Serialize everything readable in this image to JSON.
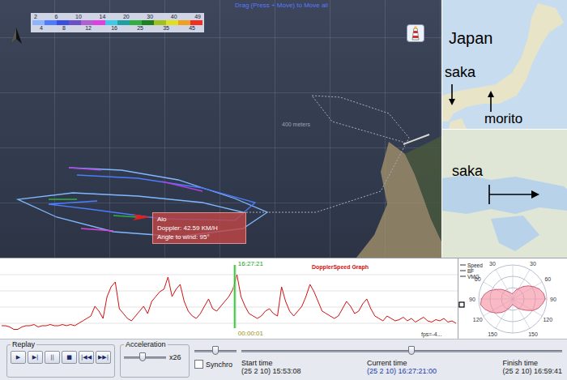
{
  "map": {
    "hint": "Drag (Press + Move) to Move all",
    "scale_text": "400 meters",
    "color_scale": {
      "colors": [
        "#8fb4ff",
        "#4f7cff",
        "#3a4fe0",
        "#6a4fc8",
        "#b060d0",
        "#e040e0",
        "#40c8e8",
        "#20a0a0",
        "#30b040",
        "#208020",
        "#a0c020",
        "#e0e020",
        "#f0a020",
        "#f03020"
      ],
      "top_labels": [
        "2",
        "6",
        "10",
        "14",
        "20",
        "30",
        "40",
        "49"
      ],
      "bottom_labels": [
        "4",
        "8",
        "12",
        "16",
        "25",
        "35",
        "45"
      ]
    },
    "tracks": [
      {
        "color": "#80b8ff",
        "kind": "solid",
        "points": [
          [
            85,
            207
          ],
          [
            150,
            210
          ],
          [
            220,
            222
          ],
          [
            290,
            245
          ],
          [
            330,
            262
          ],
          [
            300,
            282
          ],
          [
            220,
            292
          ],
          [
            140,
            286
          ],
          [
            70,
            268
          ],
          [
            22,
            246
          ],
          [
            90,
            238
          ],
          [
            170,
            242
          ],
          [
            250,
            250
          ],
          [
            300,
            262
          ]
        ]
      },
      {
        "color": "#4d7cff",
        "kind": "solid",
        "points": [
          [
            95,
            216
          ],
          [
            170,
            220
          ],
          [
            250,
            232
          ],
          [
            315,
            250
          ],
          [
            290,
            272
          ],
          [
            200,
            270
          ],
          [
            110,
            258
          ],
          [
            60,
            252
          ],
          [
            120,
            248
          ]
        ]
      },
      {
        "color": "#b040e0",
        "kind": "solid",
        "points": [
          [
            85,
            207
          ],
          [
            125,
            210
          ]
        ]
      },
      {
        "color": "#b040e0",
        "kind": "solid",
        "points": [
          [
            200,
            224
          ],
          [
            250,
            236
          ]
        ]
      },
      {
        "color": "#30b040",
        "kind": "solid",
        "points": [
          [
            60,
            246
          ],
          [
            95,
            246
          ]
        ]
      },
      {
        "color": "#30b040",
        "kind": "solid",
        "points": [
          [
            140,
            266
          ],
          [
            170,
            268
          ]
        ]
      },
      {
        "color": "#e040e0",
        "kind": "solid",
        "points": [
          [
            100,
            282
          ],
          [
            140,
            285
          ]
        ]
      },
      {
        "color": "#a8aebb",
        "kind": "dotted",
        "points": [
          [
            300,
            262
          ],
          [
            390,
            262
          ],
          [
            470,
            236
          ],
          [
            505,
            170
          ],
          [
            480,
            140
          ],
          [
            420,
            120
          ],
          [
            385,
            118
          ],
          [
            410,
            150
          ],
          [
            500,
            176
          ]
        ]
      }
    ],
    "tooltip": {
      "name": "Aio",
      "lines": [
        "Doppler: 42.59 KM/H",
        "Angle to wind: 95°"
      ]
    }
  },
  "japan_inset": {
    "title": "Japan",
    "left_label": "saka",
    "right_label": "morito"
  },
  "region_inset": {
    "label": "saka"
  },
  "speed_graph": {
    "title": "DopplerSpeed Graph",
    "values": [
      6,
      6,
      5,
      3,
      3,
      5,
      6,
      6,
      7,
      5,
      6,
      6,
      7,
      6,
      6,
      7,
      6,
      7,
      6,
      8,
      10,
      12,
      14,
      22,
      18,
      12,
      30,
      38,
      42,
      20,
      16,
      12,
      10,
      14,
      18,
      22,
      16,
      26,
      30,
      34,
      36,
      46,
      30,
      36,
      40,
      26,
      18,
      14,
      12,
      16,
      22,
      28,
      20,
      18,
      22,
      26,
      30,
      36,
      48,
      30,
      22,
      16,
      14,
      12,
      14,
      18,
      20,
      16,
      14,
      38,
      26,
      18,
      14,
      18,
      22,
      30,
      40,
      34,
      26,
      18,
      16,
      14,
      12,
      14,
      20,
      26,
      22,
      16,
      18,
      24,
      28,
      20,
      14,
      12,
      10,
      14,
      12,
      10,
      11,
      13,
      10,
      12,
      9,
      11,
      13,
      10,
      9,
      11,
      10,
      12,
      9,
      10,
      8
    ],
    "cursor": {
      "level": 0.513,
      "time": "16:27:21",
      "elapsed": "00:00:01"
    },
    "fps": "fps=-4..."
  },
  "polar": {
    "legend": [
      "Speed",
      "BF",
      "VMG"
    ],
    "right_labels": [
      "30",
      "60",
      "90",
      "120",
      "150"
    ],
    "left_labels": [
      "30",
      "60",
      "90",
      "120",
      "150"
    ],
    "values": [
      8,
      10,
      14,
      18,
      24,
      30,
      36,
      42,
      46,
      48,
      44,
      40,
      34,
      26,
      20,
      16,
      12,
      10,
      8,
      10,
      14,
      20,
      26,
      32,
      38,
      44,
      48,
      46,
      42,
      36,
      28,
      22,
      16,
      12,
      10,
      8
    ]
  },
  "controls": {
    "replay": {
      "title": "Replay",
      "buttons": [
        "▶",
        "▶|",
        "||",
        "■",
        "|◀◀",
        "▶▶|"
      ]
    },
    "acceleration": {
      "title": "Acceleration",
      "level": 0.45,
      "reading": "x26"
    },
    "position_slider": {
      "level": 0.5
    },
    "synchro": {
      "label": "Synchro",
      "checked": false
    },
    "timeline": {
      "level": 0.53
    },
    "times": [
      {
        "label": "Start time",
        "value": "(25 2 10) 15:53:08",
        "current": false
      },
      {
        "label": "Current time",
        "value": "(25 2 10) 16:27:21:00",
        "current": true
      },
      {
        "label": "Finish time",
        "value": "(25 2 10) 16:59:41",
        "current": false
      }
    ]
  }
}
